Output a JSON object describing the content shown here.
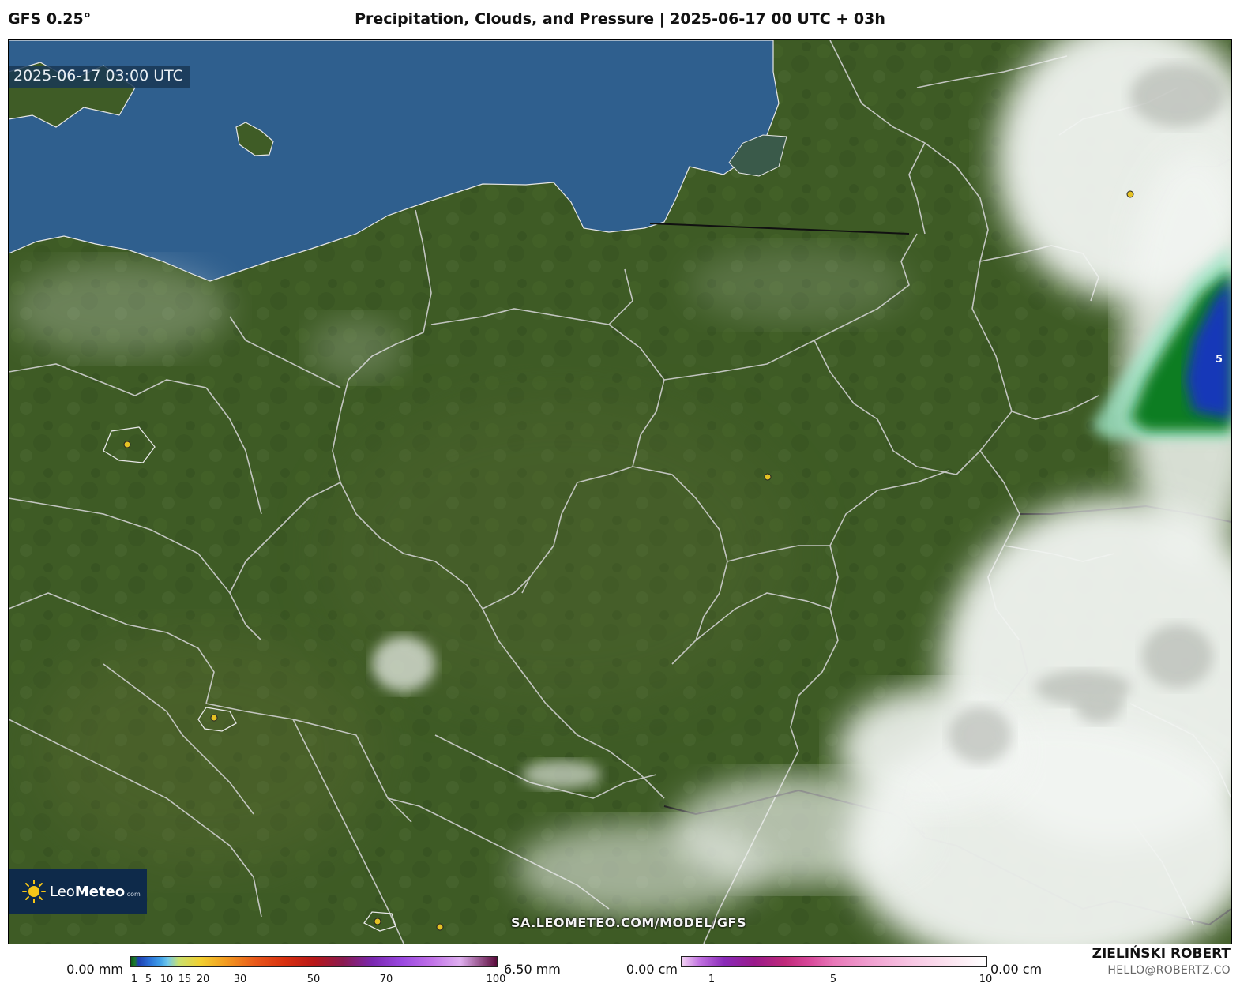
{
  "header": {
    "model": "GFS 0.25°",
    "title": "Precipitation, Clouds, and Pressure | 2025-06-17 00 UTC + 03h"
  },
  "map": {
    "valid_time": "2025-06-17 03:00 UTC",
    "watermark": "SA.LEOMETEO.COM/MODEL/GFS",
    "isobar_label": "5",
    "logo": {
      "name_light": "Leo",
      "name_bold": "Meteo",
      "suffix": ".com"
    }
  },
  "precip_legend": {
    "min_label": "0.00 mm",
    "max_label": "6.50 mm",
    "ticks": [
      "1",
      "5",
      "10",
      "15",
      "20",
      "30",
      "50",
      "70",
      "100"
    ]
  },
  "snow_legend": {
    "min_label": "0.00 cm",
    "max_label": "0.00 cm",
    "ticks": [
      "1",
      "5",
      "10"
    ]
  },
  "credits": {
    "author": "ZIELIŃSKI ROBERT",
    "email": "HELLO@ROBERTZ.CO"
  },
  "colors": {
    "sea": "#2f5f8e",
    "land": "#3f5c26",
    "clouds": "#f2f5f2",
    "precip_green": "#0f7d22",
    "precip_blue": "#1438b8",
    "borders": "#d8d8d8"
  }
}
